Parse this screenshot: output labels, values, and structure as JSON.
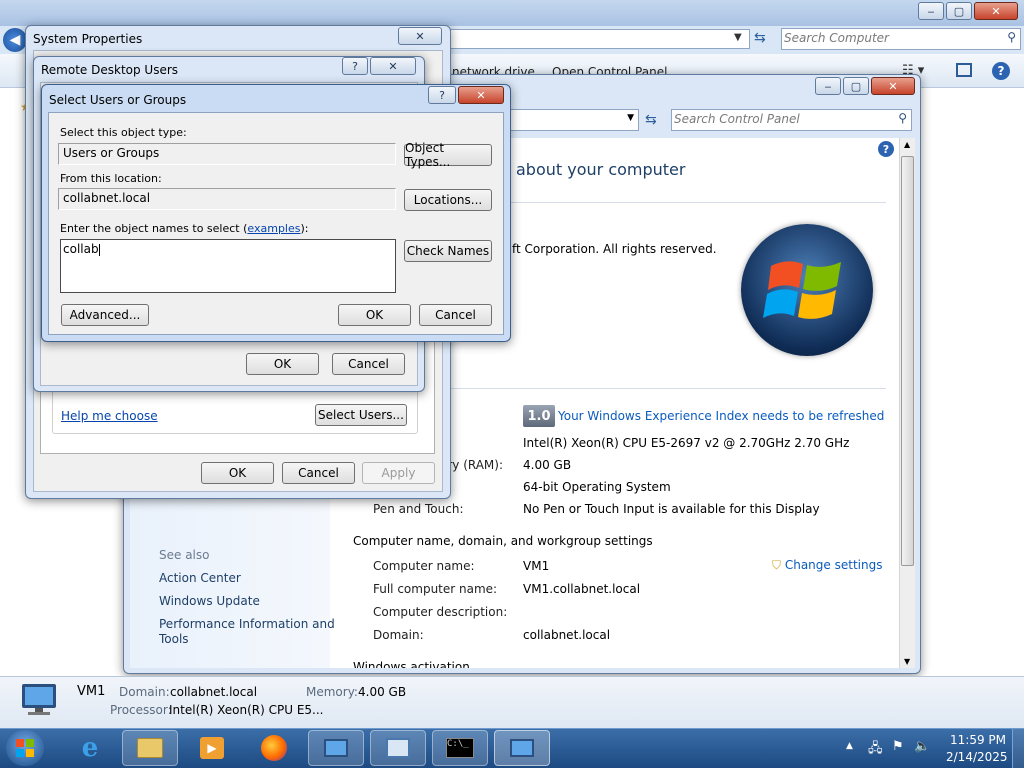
{
  "explorer_bg": {
    "search_placeholder": "Search Computer",
    "toolbar_items": [
      "network drive",
      "Open Control Panel"
    ]
  },
  "control_panel": {
    "search_placeholder": "Search Control Panel",
    "heading": "about your computer",
    "copyright": "ft Corporation.  All rights reserved.",
    "rating_score": "1.0",
    "rating_link": "Your Windows Experience Index needs to be refreshed",
    "processor": "Intel(R) Xeon(R) CPU E5-2697 v2 @ 2.70GHz   2.70 GHz",
    "memory_label": "ory (RAM):",
    "memory": "4.00 GB",
    "system_type": "64-bit Operating System",
    "pen_label": "Pen and Touch:",
    "pen_value": "No Pen or Touch Input is available for this Display",
    "section_computer": "Computer name, domain, and workgroup settings",
    "computer_name_label": "Computer name:",
    "computer_name": "VM1",
    "full_name_label": "Full computer name:",
    "full_name": "VM1.collabnet.local",
    "description_label": "Computer description:",
    "domain_label": "Domain:",
    "domain": "collabnet.local",
    "change_settings": "Change settings",
    "cut_section": "Windows activation",
    "see_also": "See also",
    "see_also_items": [
      "Action Center",
      "Windows Update",
      "Performance Information and",
      "Tools"
    ]
  },
  "system_properties": {
    "title": "System Properties",
    "help_me_choose": "Help me choose",
    "select_users": "Select Users...",
    "ok": "OK",
    "cancel": "Cancel",
    "apply": "Apply"
  },
  "remote_desktop_users": {
    "title": "Remote Desktop Users",
    "ok": "OK",
    "cancel": "Cancel"
  },
  "select_users_dialog": {
    "title": "Select Users or Groups",
    "object_type_label": "Select this object type:",
    "object_type_value": "Users or Groups",
    "object_types_button": "Object Types...",
    "location_label": "From this location:",
    "location_value": "collabnet.local",
    "locations_button": "Locations...",
    "names_label_prefix": "Enter the object names to select (",
    "names_label_link": "examples",
    "names_label_suffix": "):",
    "names_value": "collab",
    "check_names_button": "Check Names",
    "advanced_button": "Advanced...",
    "ok": "OK",
    "cancel": "Cancel"
  },
  "details_pane": {
    "computer_name": "VM1",
    "domain_label": "Domain:",
    "domain": "collabnet.local",
    "memory_label": "Memory:",
    "memory": "4.00 GB",
    "processor_label": "Processor:",
    "processor": "Intel(R) Xeon(R) CPU E5..."
  },
  "taskbar": {
    "time": "11:59 PM",
    "date": "2/14/2025"
  },
  "colors": {
    "taskbar": "#2a5a94",
    "aero_frame": "#dbe7f6",
    "link": "#0645ad",
    "heading": "#1e3f66"
  }
}
